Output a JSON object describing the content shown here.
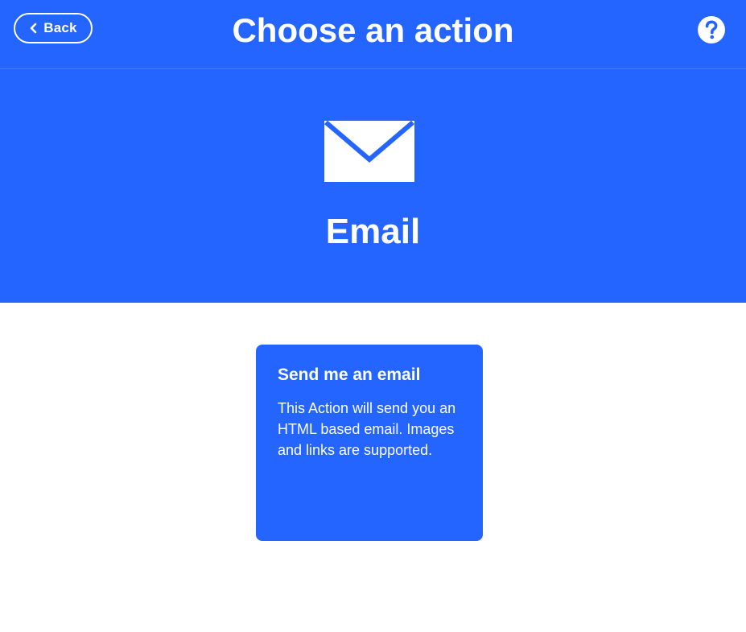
{
  "colors": {
    "brand_blue": "#2464ff",
    "background": "#ffffff",
    "text_on_blue": "#ffffff"
  },
  "topbar": {
    "back_label": "Back",
    "back_icon": "chevron-left-icon",
    "title": "Choose an action",
    "help_icon": "question-circle-icon"
  },
  "service": {
    "icon": "envelope-icon",
    "name": "Email"
  },
  "actions": [
    {
      "title": "Send me an email",
      "description": "This Action will send you an HTML based email. Images and links are supported."
    }
  ]
}
